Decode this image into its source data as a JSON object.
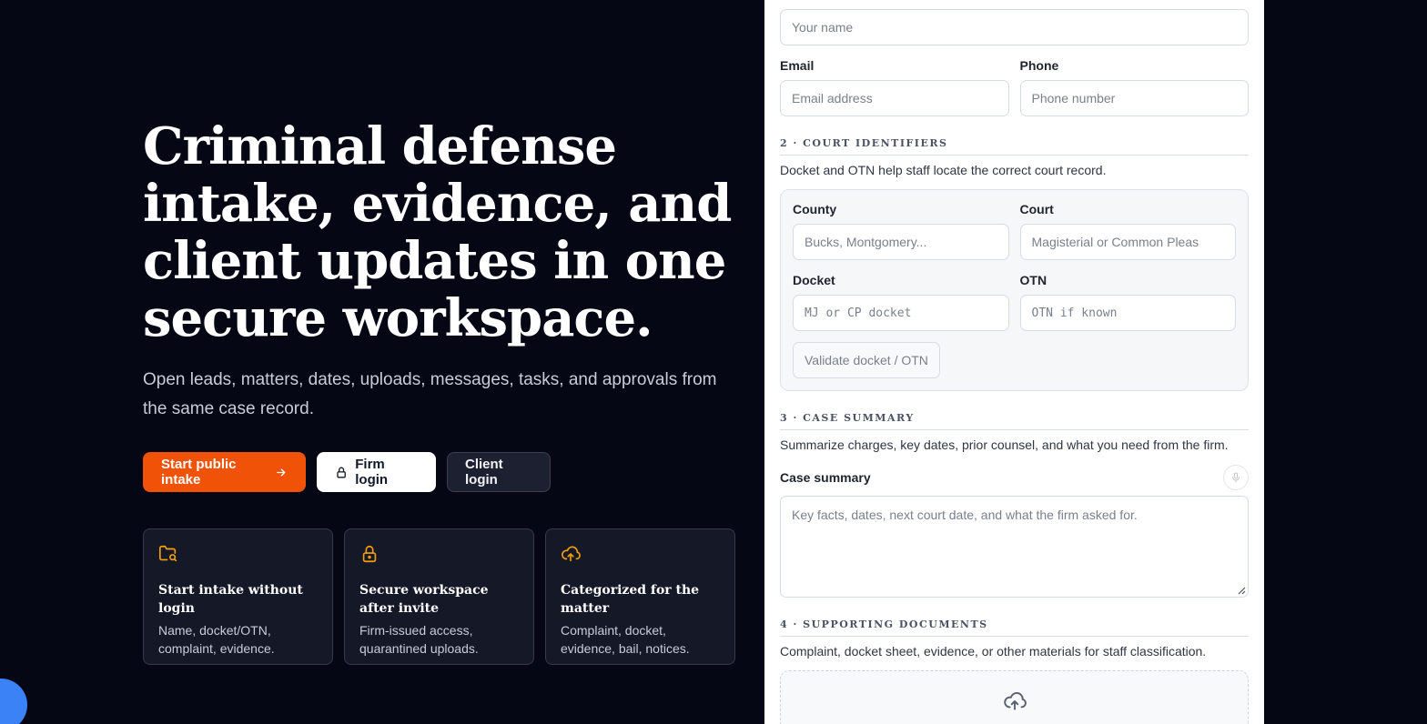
{
  "hero": {
    "headline": "Criminal defense intake, evidence, and client updates in one secure workspace.",
    "subtext": "Open leads, matters, dates, uploads, messages, tasks, and approvals from the same case record."
  },
  "cta": {
    "primary": "Start public intake",
    "firm_login": "Firm login",
    "client_login": "Client login"
  },
  "features": [
    {
      "icon": "folder-search-icon",
      "title": "Start intake without login",
      "desc": "Name, docket/OTN, complaint, evidence."
    },
    {
      "icon": "lock-icon",
      "title": "Secure workspace after invite",
      "desc": "Firm-issued access, quarantined uploads."
    },
    {
      "icon": "cloud-upload-icon",
      "title": "Categorized for the matter",
      "desc": "Complaint, docket, evidence, bail, notices."
    }
  ],
  "form": {
    "name_placeholder": "Your name",
    "email_label": "Email",
    "email_placeholder": "Email address",
    "phone_label": "Phone",
    "phone_placeholder": "Phone number",
    "section2": {
      "title": "2 · COURT IDENTIFIERS",
      "desc": "Docket and OTN help staff locate the correct court record.",
      "county_label": "County",
      "county_placeholder": "Bucks, Montgomery...",
      "court_label": "Court",
      "court_placeholder": "Magisterial or Common Pleas",
      "docket_label": "Docket",
      "docket_placeholder": "MJ or CP docket",
      "otn_label": "OTN",
      "otn_placeholder": "OTN if known",
      "validate_label": "Validate docket / OTN"
    },
    "section3": {
      "title": "3 · CASE SUMMARY",
      "desc": "Summarize charges, key dates, prior counsel, and what you need from the firm.",
      "summary_label": "Case summary",
      "summary_placeholder": "Key facts, dates, next court date, and what the firm asked for."
    },
    "section4": {
      "title": "4 · SUPPORTING DOCUMENTS",
      "desc": "Complaint, docket sheet, evidence, or other materials for staff classification."
    }
  },
  "colors": {
    "background": "#050814",
    "accent": "#f05208",
    "feature_icon": "#f59e0b",
    "float_button": "#3b82f6"
  }
}
